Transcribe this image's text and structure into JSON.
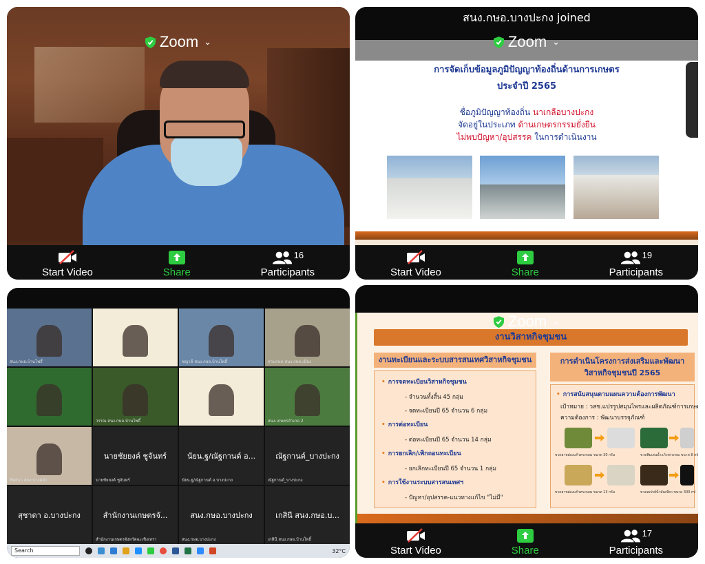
{
  "panel1": {
    "zoom_title": "Zoom",
    "controls": {
      "start_video": "Start Video",
      "share": "Share",
      "participants": "Participants",
      "participant_count": "16"
    }
  },
  "panel2": {
    "joined_banner": "สนง.กษอ.บางปะกง joined",
    "zoom_title": "Zoom",
    "slide": {
      "title_line1": "การจัดเก็บข้อมูลภูมิปัญญาท้องถิ่นด้านการเกษตร",
      "title_line2": "ประจำปี 2565",
      "line1_label": "ชื่อภูมิปัญญาท้องถิ่น",
      "line1_value": "นาเกลือบางปะกง",
      "line2_label": "จัดอยู่ในประเภท",
      "line2_value": "ด้านเกษตรกรรมยั่งยืน",
      "line3_label": "ไม่พบปัญหา/อุปสรรค",
      "line3_value": "ในการดำเนินงาน"
    },
    "controls": {
      "start_video": "Start Video",
      "share": "Share",
      "participants": "Participants",
      "participant_count": "19"
    }
  },
  "panel3": {
    "tiles": [
      {
        "name": "",
        "sub": "สนง.กษอ.บ้านโพธิ์",
        "kind": "video",
        "bg": "#5a7190"
      },
      {
        "name": "",
        "sub": "",
        "kind": "video",
        "bg": "#f3ecd8"
      },
      {
        "name": "",
        "sub": "ชญาดี สนง.กษอ.บ้านโพธิ์",
        "kind": "video",
        "bg": "#6b87a8"
      },
      {
        "name": "",
        "sub": "สวนกษต สนง.กษอ.เมือง",
        "kind": "video",
        "bg": "#a7a08a"
      },
      {
        "name": "",
        "sub": "",
        "kind": "video",
        "bg": "#2f6b2f"
      },
      {
        "name": "",
        "sub": "วรรณ สนง.กษอ.บ้านโพธิ์",
        "kind": "video",
        "bg": "#3a5a2a"
      },
      {
        "name": "",
        "sub": "",
        "kind": "video",
        "bg": "#f3ecd8"
      },
      {
        "name": "",
        "sub": "สนง.เกษตรอำเภอ 2",
        "kind": "video",
        "bg": "#4c7b3f"
      },
      {
        "name": "",
        "sub": "ทิพย์นา สนง.บางคล้า",
        "kind": "video",
        "bg": "#c7b8a6"
      },
      {
        "name": "นายชัยยงค์ ชูจันทร์",
        "sub": "นายชัยยงค์ ชูจันทร์",
        "kind": "name"
      },
      {
        "name": "นัยน.ฐ/ณัฐกานต์ อ...",
        "sub": "นัยน.ฐ/ณัฐกานต์ อ.บางปะกง",
        "kind": "name"
      },
      {
        "name": "ณัฐกานต์_บางปะกง",
        "sub": "ณัฐกานต์_บางปะกง",
        "kind": "name"
      },
      {
        "name": "สุชาดา อ.บางปะกง",
        "sub": "",
        "kind": "name"
      },
      {
        "name": "สำนักงานเกษตรจั...",
        "sub": "สำนักงานเกษตรจังหวัดฉะเชิงเทรา",
        "kind": "name"
      },
      {
        "name": "สนง.กษอ.บางปะกง",
        "sub": "สนง.กษอ.บางปะกง",
        "kind": "name"
      },
      {
        "name": "เกสินี สนง.กษอ.บ...",
        "sub": "เกสินี สนง.กษอ.บ้านโพธิ์",
        "kind": "name"
      }
    ],
    "taskbar": {
      "search": "Search",
      "temp": "32°C"
    }
  },
  "panel4": {
    "zoom_title": "Zoom",
    "slide": {
      "title": "งานวิสาหกิจชุมชน",
      "left_header": "งานทะเบียนและระบบสารสนเทศวิสาหกิจชุมชน",
      "left_items": [
        {
          "text": "การจดทะเบียนวิสาหกิจชุมชน",
          "bold": true
        },
        {
          "text": "- จำนวนทั้งสิ้น 45 กลุ่ม",
          "bold": false
        },
        {
          "text": "- จดทะเบียนปี 65 จำนวน 6 กลุ่ม",
          "bold": false
        },
        {
          "text": "การต่อทะเบียน",
          "bold": true
        },
        {
          "text": "- ต่อทะเบียนปี 65 จำนวน 14 กลุ่ม",
          "bold": false
        },
        {
          "text": "การยกเลิก/เพิกถอนทะเบียน",
          "bold": true
        },
        {
          "text": "- ยกเลิกทะเบียนปี 65 จำนวน 1 กลุ่ม",
          "bold": false
        },
        {
          "text": "การใช้งานระบบสารสนเทศฯ",
          "bold": true
        },
        {
          "text": "- ปัญหา/อุปสรรค-แนวทางแก้ไข \"ไม่มี\"",
          "bold": false
        }
      ],
      "right_header_line1": "การดำเนินโครงการส่งเสริมและพัฒนา",
      "right_header_line2": "วิสาหกิจชุมชนปี 2565",
      "right_bullet": "การสนับสนุนตามแผนความต้องการพัฒนา",
      "right_target": "เป้าหมาย : วสช.แปรรูปสมุนไพรและผลิตภัณฑ์การเกษตร",
      "right_need": "ความต้องการ : พัฒนาบรรจุภัณฑ์",
      "captions": [
        "ขวดยาหม่องแก้วทรงกลม ขนาด 30 กรัม",
        "ขวดพิมเสนน้ำแก้วทรงกลม ขนาด 8 ml",
        "ขวดยาหม่องแก้วทรงกลม ขนาด 13 กรัม",
        "ขวดสเปรย์น้ำมันเขียว ขนาด 300 ml"
      ]
    },
    "controls": {
      "start_video": "Start Video",
      "share": "Share",
      "participants": "Participants",
      "participant_count": "17"
    }
  }
}
